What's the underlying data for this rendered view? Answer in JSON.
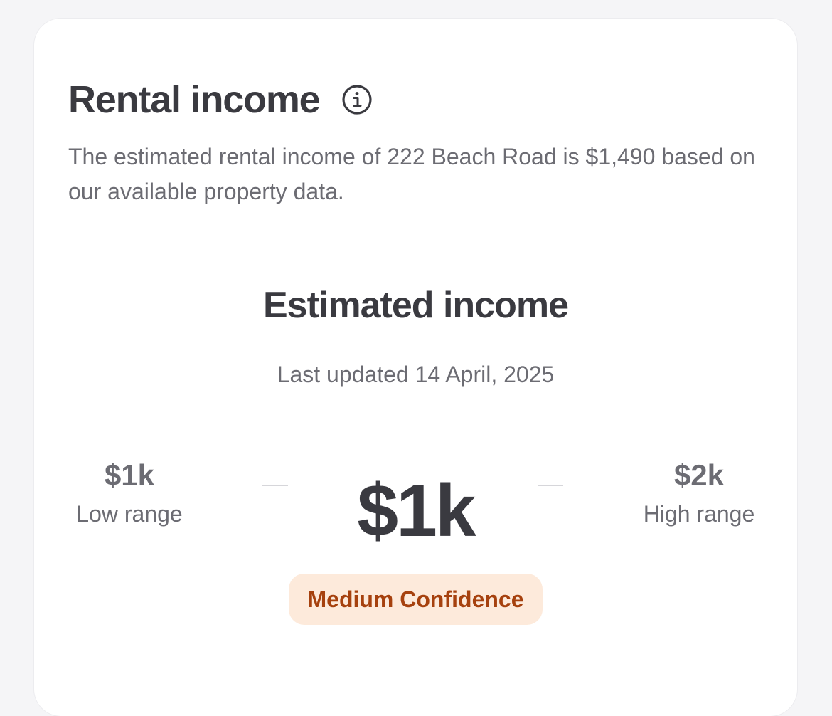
{
  "card": {
    "title": "Rental income",
    "info_icon": "info-icon",
    "description": "The estimated rental income of 222 Beach Road is $1,490 based on our available property data."
  },
  "estimate": {
    "title": "Estimated income",
    "last_updated": "Last updated 14 April, 2025",
    "low_value": "$1k",
    "low_label": "Low range",
    "main_value": "$1k",
    "high_value": "$2k",
    "high_label": "High range",
    "confidence": "Medium Confidence"
  },
  "colors": {
    "background": "#f5f5f7",
    "card": "#ffffff",
    "heading": "#3a3a40",
    "body_text": "#6c6c73",
    "badge_bg": "#fdeadb",
    "badge_text": "#a6410e"
  }
}
